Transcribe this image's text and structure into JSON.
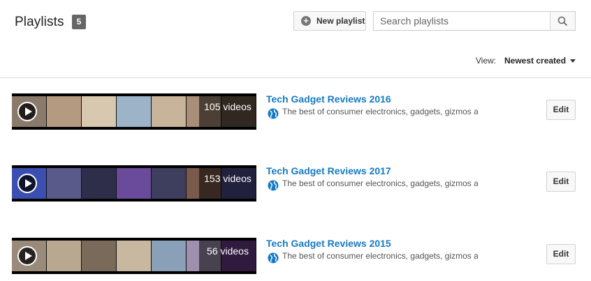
{
  "header": {
    "title": "Playlists",
    "count": "5",
    "new_playlist_label": "New playlist",
    "search_placeholder": "Search playlists",
    "view_label": "View:",
    "view_selected": "Newest created"
  },
  "colors": {
    "link": "#167ac6",
    "badge": "#666666"
  },
  "playlists": [
    {
      "title": "Tech Gadget Reviews 2016",
      "video_count": "105 videos",
      "description": "The best of consumer electronics, gadgets, gizmos and d",
      "privacy_icon": "globe-icon",
      "edit_label": "Edit",
      "thumb_colors": [
        "#8a7a6a",
        "#b59a82",
        "#d8c8b0",
        "#9db3c8",
        "#c7b49a",
        "#a98f78",
        "#6b5a4a"
      ]
    },
    {
      "title": "Tech Gadget Reviews 2017",
      "video_count": "153 videos",
      "description": "The best of consumer electronics, gadgets, gizmos and d",
      "privacy_icon": "globe-icon",
      "edit_label": "Edit",
      "thumb_colors": [
        "#3a4fb0",
        "#5a5a8a",
        "#2e2e4a",
        "#6a4a9a",
        "#3e3e5e",
        "#7a5a4a",
        "#4a4a8a"
      ]
    },
    {
      "title": "Tech Gadget Reviews 2015",
      "video_count": "56 videos",
      "description": "The best of consumer electronics, gadgets, gizmos and d",
      "privacy_icon": "globe-icon",
      "edit_label": "Edit",
      "thumb_colors": [
        "#9a8a7a",
        "#b8a890",
        "#7a6a5a",
        "#c8b8a0",
        "#8aa0b8",
        "#a090b0",
        "#6a3a8a"
      ]
    }
  ]
}
